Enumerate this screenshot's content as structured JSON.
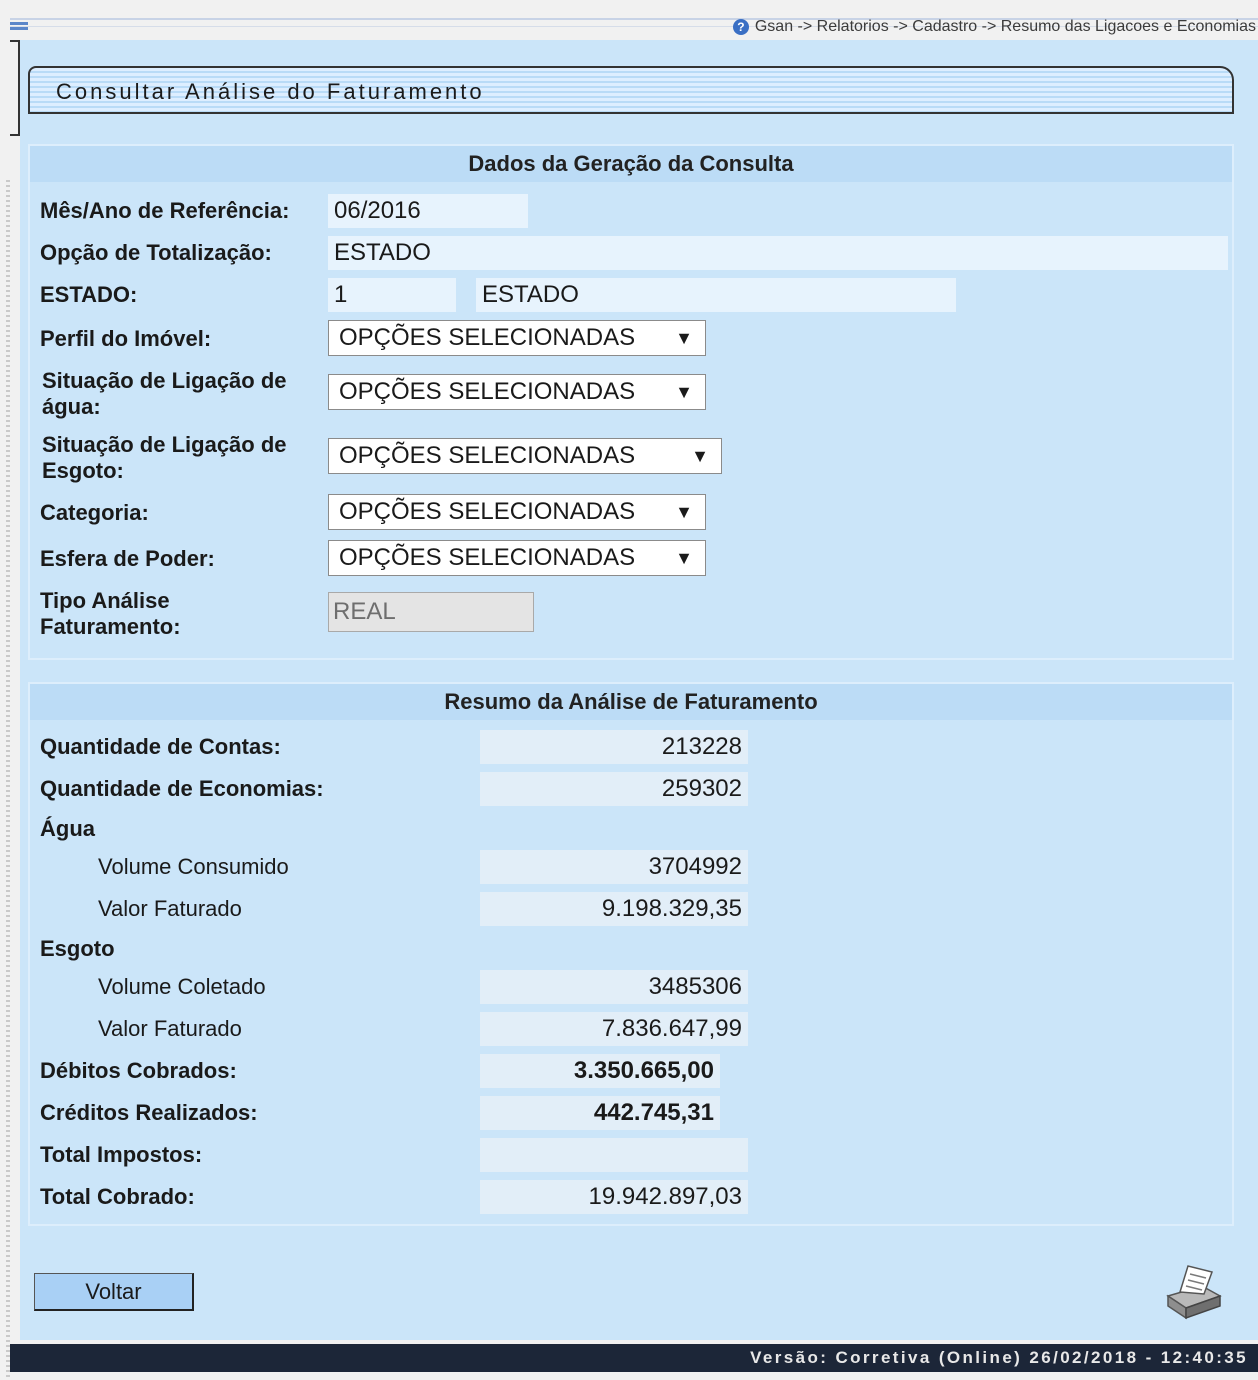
{
  "breadcrumb": "Gsan -> Relatorios -> Cadastro -> Resumo das Ligacoes e Economias",
  "page_title": "Consultar Análise do Faturamento",
  "dados": {
    "header": "Dados da Geração da Consulta",
    "mes_ano_label": "Mês/Ano de Referência:",
    "mes_ano_value": "06/2016",
    "opcao_label": "Opção de Totalização:",
    "opcao_value": "ESTADO",
    "estado_label": "ESTADO:",
    "estado_code": "1",
    "estado_name": "ESTADO",
    "perfil_label": "Perfil do Imóvel:",
    "perfil_value": "OPÇÕES SELECIONADAS",
    "sit_agua_label_1": "Situação de Ligação de",
    "sit_agua_label_2": "água:",
    "sit_agua_value": "OPÇÕES SELECIONADAS",
    "sit_esgoto_label_1": "Situação de Ligação de",
    "sit_esgoto_label_2": "Esgoto:",
    "sit_esgoto_value": "OPÇÕES SELECIONADAS",
    "categoria_label": "Categoria:",
    "categoria_value": "OPÇÕES SELECIONADAS",
    "esfera_label": "Esfera de Poder:",
    "esfera_value": "OPÇÕES SELECIONADAS",
    "tipo_label_1": "Tipo Análise",
    "tipo_label_2": "Faturamento:",
    "tipo_value": "REAL"
  },
  "resumo": {
    "header": "Resumo da Análise de Faturamento",
    "qtd_contas_label": "Quantidade de Contas:",
    "qtd_contas_value": "213228",
    "qtd_economias_label": "Quantidade de Economias:",
    "qtd_economias_value": "259302",
    "agua_label": "Água",
    "agua_volume_label": "Volume Consumido",
    "agua_volume_value": "3704992",
    "agua_valor_label": "Valor Faturado",
    "agua_valor_value": "9.198.329,35",
    "esgoto_label": "Esgoto",
    "esgoto_volume_label": "Volume Coletado",
    "esgoto_volume_value": "3485306",
    "esgoto_valor_label": "Valor Faturado",
    "esgoto_valor_value": "7.836.647,99",
    "debitos_label": "Débitos Cobrados:",
    "debitos_value": "3.350.665,00",
    "creditos_label": "Créditos Realizados:",
    "creditos_value": "442.745,31",
    "impostos_label": "Total Impostos:",
    "impostos_value": "",
    "total_label": "Total Cobrado:",
    "total_value": "19.942.897,03"
  },
  "buttons": {
    "voltar": "Voltar"
  },
  "icons": {
    "help": "help-icon",
    "printer": "printer-icon",
    "dropdown": "dropdown-arrow-icon",
    "arrow_glyph": "▼",
    "help_glyph": "?"
  },
  "footer": "Versão: Corretiva (Online) 26/02/2018 - 12:40:35",
  "colors": {
    "panel": "#cbe5f9",
    "header": "#bcdcf6",
    "footer": "#1c2638"
  }
}
